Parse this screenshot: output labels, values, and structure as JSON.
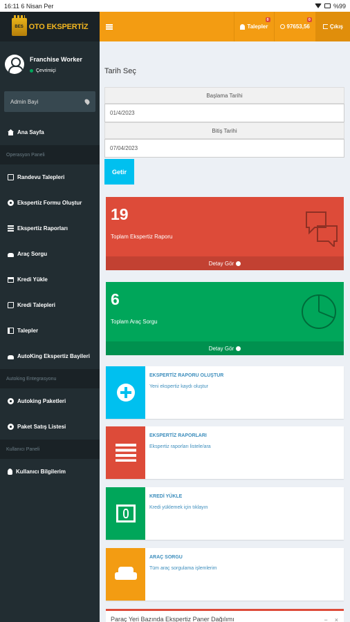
{
  "status_bar": {
    "time": "16:11",
    "date": "6 Nisan Per",
    "battery": "%99"
  },
  "brand": {
    "badge": "BES",
    "name": "OTO EKSPERTİZ"
  },
  "user": {
    "name": "Franchise Worker",
    "status": "Çevrimiçi"
  },
  "search": {
    "label": "Admin Bayi"
  },
  "menu": {
    "home": "Ana Sayfa",
    "header_operations": "Operasyon Paneli",
    "appointments": "Randevu Talepleri",
    "create_form": "Ekspertiz Formu Oluştur",
    "reports": "Ekspertiz Raporları",
    "vehicle_query": "Araç Sorgu",
    "credit_load": "Kredi Yükle",
    "credit_requests": "Kredi Talepleri",
    "requests": "Talepler",
    "dealers": "AutoKing Ekspertiz Bayileri",
    "header_integration": "Autoking Entegrasyonu",
    "packages": "Autoking Paketleri",
    "package_sales": "Paket Satış Listesi",
    "header_user": "Kullanıcı Paneli",
    "user_info": "Kullanıcı Bilgilerim"
  },
  "topbar": {
    "requests": "Talepler",
    "requests_badge": "0",
    "balance": "97653,56",
    "balance_badge": "0",
    "exit": "Çıkış"
  },
  "filter": {
    "title": "Tarih Seç",
    "start_label": "Başlama Tarihi",
    "start_value": "01/4/2023",
    "end_label": "Bitiş Tarihi",
    "end_value": "07/04/2023",
    "submit": "Getir"
  },
  "stats": [
    {
      "value": "19",
      "label": "Toplam Ekspertiz Raporu",
      "footer": "Detay Gör"
    },
    {
      "value": "6",
      "label": "Toplam Araç Sorgu",
      "footer": "Detay Gör"
    }
  ],
  "actions": [
    {
      "title": "EKSPERTİZ RAPORU OLUŞTUR",
      "subtitle": "Yeni ekspertiz kaydı oluştur"
    },
    {
      "title": "EKSPERTİZ RAPORLARI",
      "subtitle": "Ekspertiz raporları listele/ara"
    },
    {
      "title": "KREDİ YÜKLE",
      "subtitle": "Kredi yüklemek için tıklayın"
    },
    {
      "title": "ARAÇ SORGU",
      "subtitle": "Tüm araç sorgulama işlemlerim"
    }
  ],
  "bottom_panel": {
    "title": "Paraç Yeri Bazında Ekspertiz Paner Dağılımı",
    "minimize": "−",
    "close": "×"
  },
  "colors": {
    "sidebar": "#222d32",
    "topbar": "#f39c12",
    "red": "#dd4b39",
    "green": "#00a65a",
    "aqua": "#00c0ef"
  }
}
